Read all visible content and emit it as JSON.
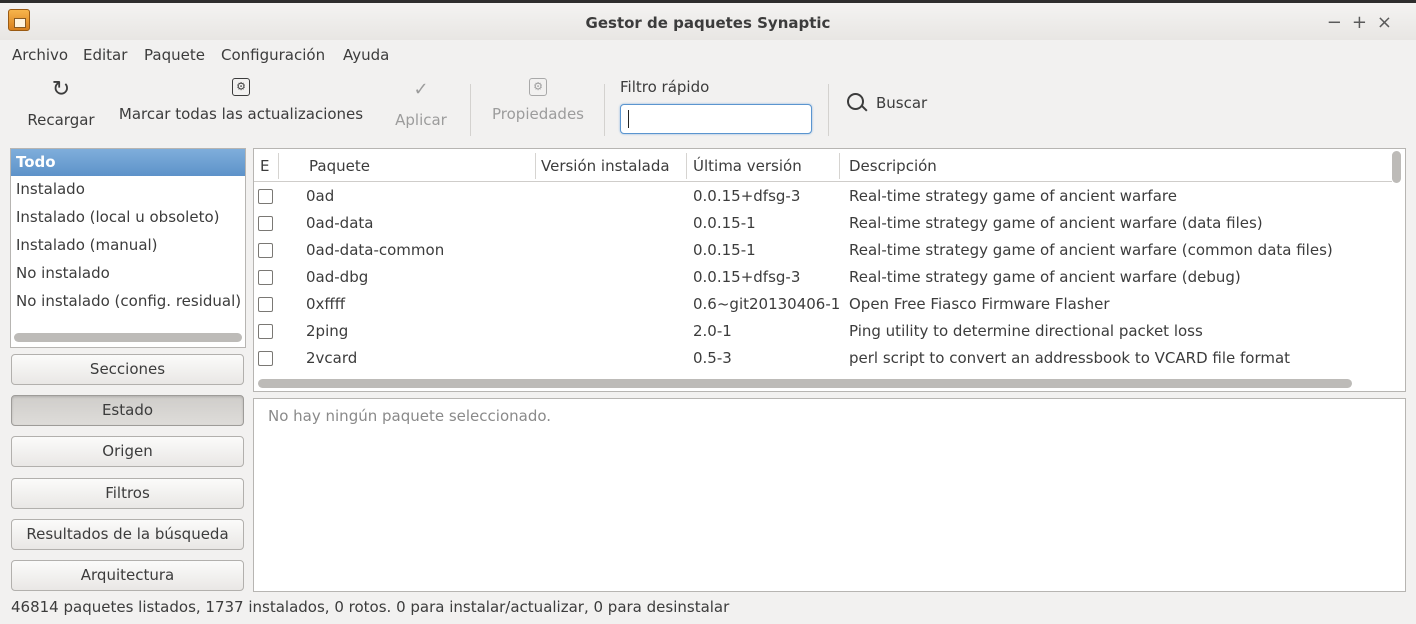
{
  "window": {
    "title": "Gestor de paquetes Synaptic",
    "controls": [
      "−",
      "+",
      "×"
    ]
  },
  "menu": [
    "Archivo",
    "Editar",
    "Paquete",
    "Configuración",
    "Ayuda"
  ],
  "toolbar": {
    "reload": {
      "label": "Recargar",
      "icon": "reload-icon"
    },
    "mark_all": {
      "label": "Marcar todas las actualizaciones",
      "icon": "mark-upgrades-icon"
    },
    "apply": {
      "label": "Aplicar",
      "icon": "check-icon",
      "enabled": false
    },
    "properties": {
      "label": "Propiedades",
      "icon": "properties-icon",
      "enabled": false
    },
    "quick_filter": {
      "label": "Filtro rápido",
      "value": ""
    },
    "search": {
      "label": "Buscar",
      "icon": "search-icon"
    }
  },
  "filters": [
    "Todo",
    "Instalado",
    "Instalado (local u obsoleto)",
    "Instalado (manual)",
    "No instalado",
    "No instalado (config. residual)"
  ],
  "selected_filter": "Todo",
  "nav_buttons": [
    "Secciones",
    "Estado",
    "Origen",
    "Filtros",
    "Resultados de la búsqueda",
    "Arquitectura"
  ],
  "active_nav": "Estado",
  "table": {
    "columns": [
      "E",
      "Paquete",
      "Versión instalada",
      "Última versión",
      "Descripción"
    ],
    "rows": [
      {
        "name": "0ad",
        "installed": "",
        "latest": "0.0.15+dfsg-3",
        "description": "Real-time strategy game of ancient warfare"
      },
      {
        "name": "0ad-data",
        "installed": "",
        "latest": "0.0.15-1",
        "description": "Real-time strategy game of ancient warfare (data files)"
      },
      {
        "name": "0ad-data-common",
        "installed": "",
        "latest": "0.0.15-1",
        "description": "Real-time strategy game of ancient warfare (common data files)"
      },
      {
        "name": "0ad-dbg",
        "installed": "",
        "latest": "0.0.15+dfsg-3",
        "description": "Real-time strategy game of ancient warfare (debug)"
      },
      {
        "name": "0xffff",
        "installed": "",
        "latest": "0.6~git20130406-1",
        "description": "Open Free Fiasco Firmware Flasher"
      },
      {
        "name": "2ping",
        "installed": "",
        "latest": "2.0-1",
        "description": "Ping utility to determine directional packet loss"
      },
      {
        "name": "2vcard",
        "installed": "",
        "latest": "0.5-3",
        "description": "perl script to convert an addressbook to VCARD file format"
      }
    ]
  },
  "details": "No hay ningún paquete seleccionado.",
  "status": "46814 paquetes listados, 1737 instalados, 0 rotos. 0 para instalar/actualizar, 0 para desinstalar"
}
